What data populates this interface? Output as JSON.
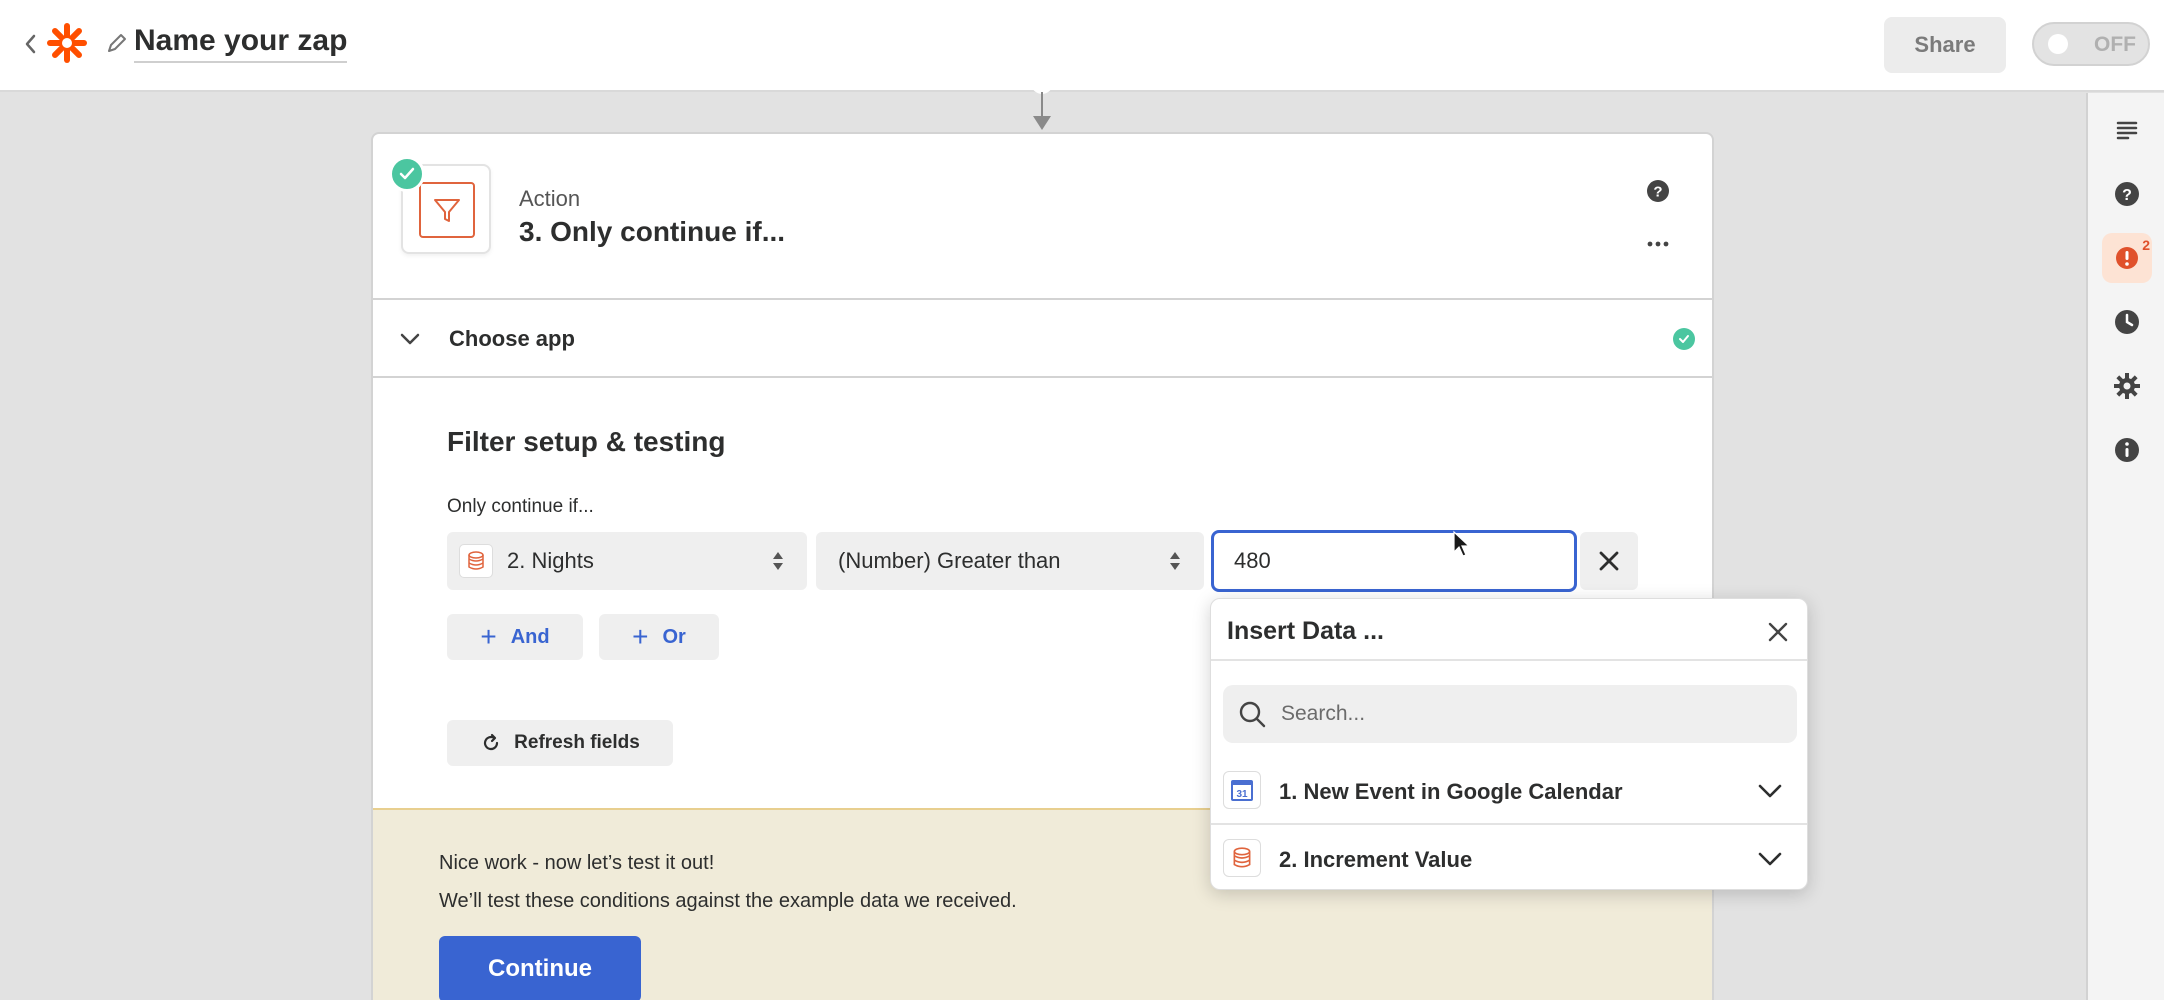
{
  "header": {
    "zap_name": "Name your zap",
    "share_label": "Share",
    "toggle_state": "OFF",
    "icons": [
      "back-chevron-icon",
      "zapier-logo-icon",
      "pencil-icon"
    ],
    "brand_color": "#ff4f00"
  },
  "sidebar": {
    "items": [
      {
        "icon": "outline-icon"
      },
      {
        "icon": "help-icon"
      },
      {
        "icon": "alert-icon",
        "badge": "2"
      },
      {
        "icon": "history-icon"
      },
      {
        "icon": "settings-icon"
      },
      {
        "icon": "info-icon"
      }
    ]
  },
  "step": {
    "type_label": "Action",
    "title": "3. Only continue if...",
    "status": "complete",
    "section_label": "Choose app"
  },
  "filter": {
    "title": "Filter setup & testing",
    "condition_label": "Only continue if...",
    "field": "2. Nights",
    "operator": "(Number) Greater than",
    "value": "480",
    "and_label": "And",
    "or_label": "Or",
    "refresh_label": "Refresh fields"
  },
  "test": {
    "line1": "Nice work - now let’s test it out!",
    "line2": "We’ll test these conditions against the example data we received.",
    "continue_label": "Continue"
  },
  "insert_data": {
    "title": "Insert Data ...",
    "search_placeholder": "Search...",
    "items": [
      {
        "label": "1. New Event in Google Calendar",
        "icon": "google-calendar-icon"
      },
      {
        "label": "2. Increment Value",
        "icon": "storage-icon"
      }
    ]
  },
  "colors": {
    "accent_blue": "#3964d1",
    "success_green": "#4bc6a0",
    "filter_orange": "#e0643d",
    "test_panel_bg": "#f0ebd9"
  }
}
